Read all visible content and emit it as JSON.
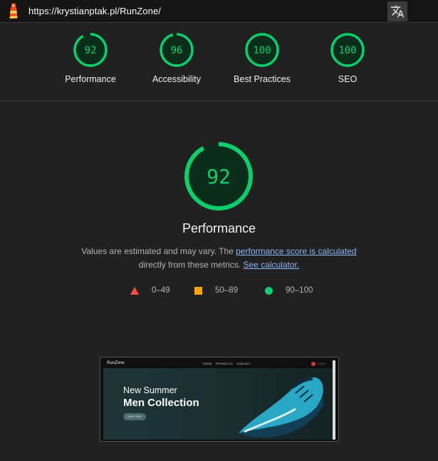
{
  "topbar": {
    "url": "https://krystianptak.pl/RunZone/",
    "logo_icon": "lighthouse-icon",
    "translate_icon": "translate-icon"
  },
  "categories": [
    {
      "label": "Performance",
      "score": "92"
    },
    {
      "label": "Accessibility",
      "score": "96"
    },
    {
      "label": "Best Practices",
      "score": "100"
    },
    {
      "label": "SEO",
      "score": "100"
    }
  ],
  "main": {
    "score": "92",
    "title": "Performance",
    "desc_prefix": "Values are estimated and may vary. The ",
    "desc_link": "performance score is calculated",
    "desc_mid": "directly from these metrics. ",
    "desc_calc_link": "See calculator."
  },
  "legend": [
    {
      "range": "0–49",
      "icon": "triangle-icon",
      "color": "#ff4e42"
    },
    {
      "range": "50–89",
      "icon": "square-icon",
      "color": "#ffa400"
    },
    {
      "range": "90–100",
      "icon": "circle-icon",
      "color": "#0cce6b"
    }
  ],
  "screenshot": {
    "brand": "RunZone",
    "nav_links": [
      "HOME",
      "PRODUCTS",
      "CONTACT"
    ],
    "login": "LOGIN",
    "hero_sub": "New Summer",
    "hero_title": "Men Collection",
    "hero_button": "SHOP NOW"
  },
  "colors": {
    "pass": "#0cce6b",
    "pass_bg": "#0b2e1c",
    "link": "#8ab4f8"
  }
}
